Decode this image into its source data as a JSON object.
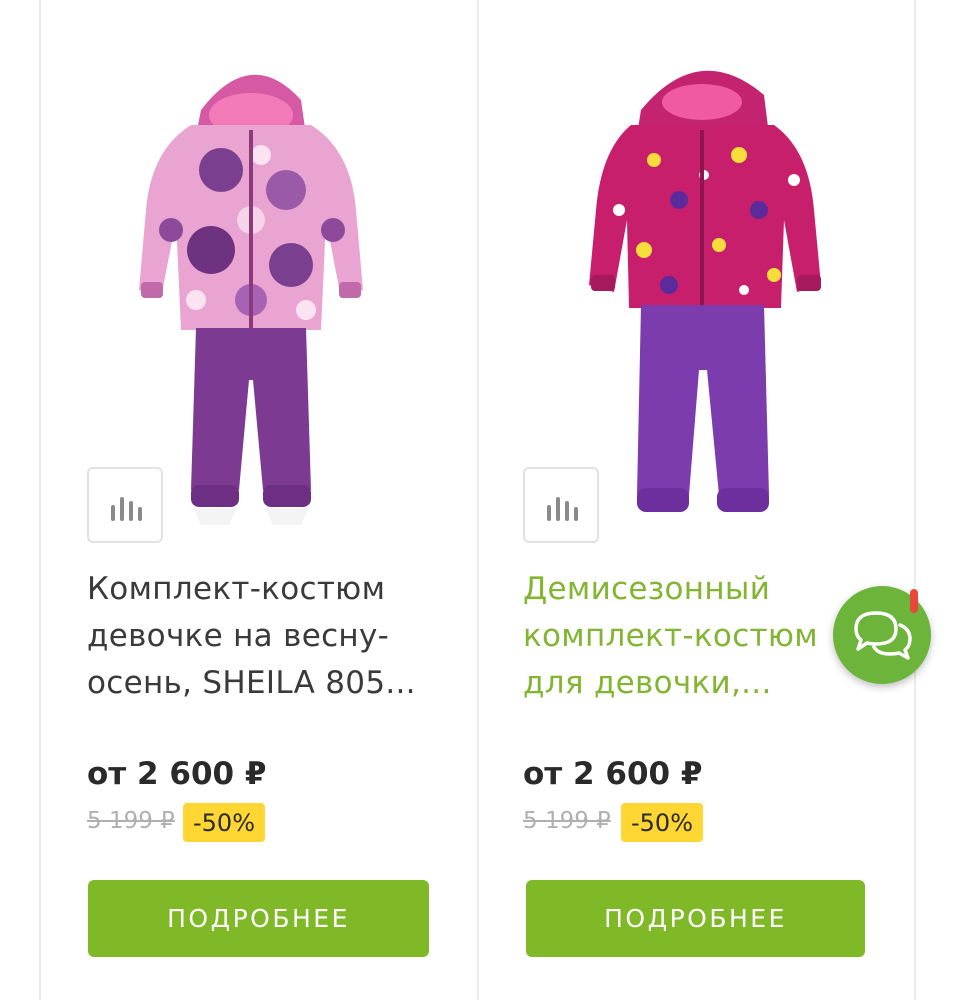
{
  "products": [
    {
      "title": "Комплект-костюм девочке на весну-осень, SHEILA 805...",
      "price_current": "от 2 600 ₽",
      "price_old": "5 199 ₽",
      "discount": "-50%",
      "details_label": "ПОДРОБНЕЕ",
      "compare_icon": "bar-chart-icon",
      "image_description": "pink-purple-flower-print-jacket-with-purple-pants"
    },
    {
      "title": "Демисезонный комплект-костюм для девочки,...",
      "price_current": "от 2 600 ₽",
      "price_old": "5 199 ₽",
      "discount": "-50%",
      "details_label": "ПОДРОБНЕЕ",
      "compare_icon": "bar-chart-icon",
      "image_description": "magenta-cat-print-jacket-with-purple-pants"
    }
  ],
  "chat": {
    "icon": "chat-bubbles-icon"
  },
  "colors": {
    "accent_green": "#80b927",
    "title_link_green": "#82b531",
    "discount_yellow": "#ffd632",
    "chat_green": "#6cb43a"
  }
}
